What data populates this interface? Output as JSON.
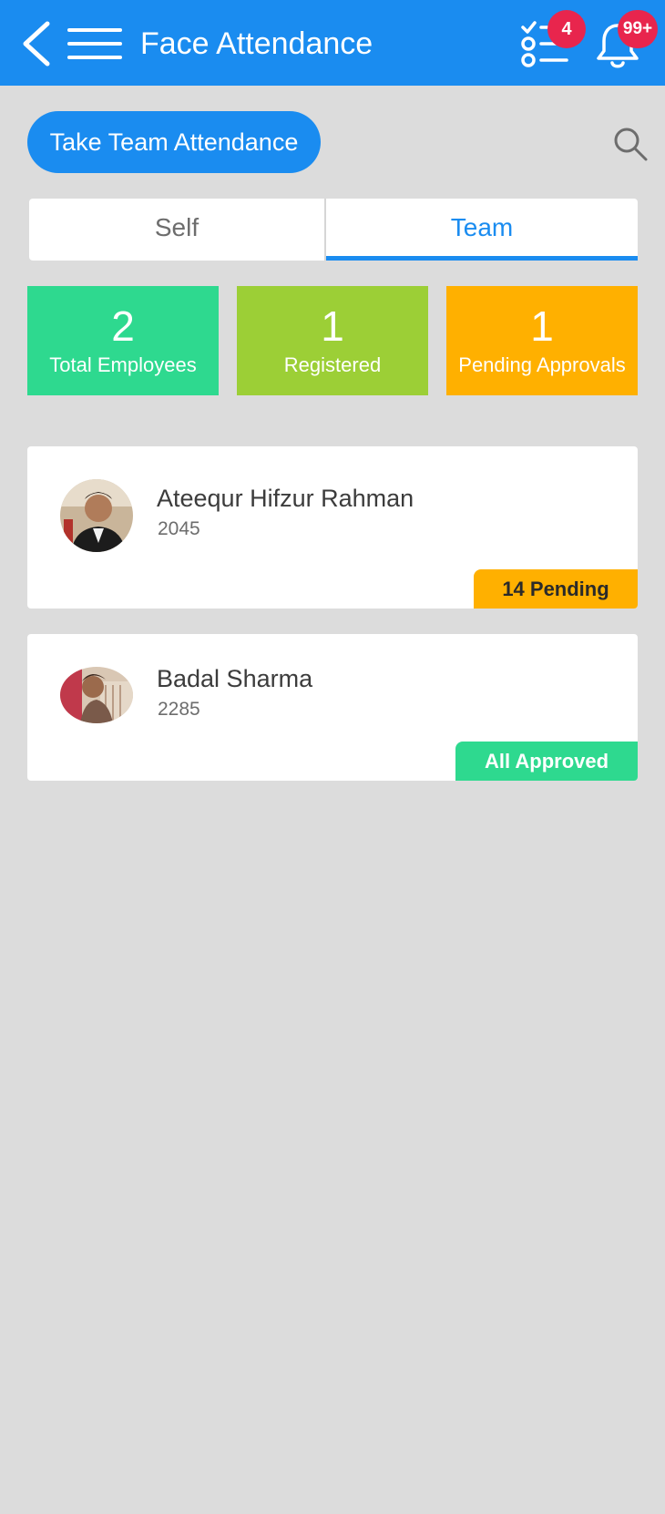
{
  "app_bar": {
    "title": "Face Attendance",
    "tasks_badge": "4",
    "notifications_badge": "99+"
  },
  "actions": {
    "take_team_attendance_label": "Take Team Attendance"
  },
  "tabs": [
    {
      "label": "Self",
      "selected": false
    },
    {
      "label": "Team",
      "selected": true
    }
  ],
  "stats": {
    "total_employees": {
      "value": "2",
      "label": "Total Employees"
    },
    "registered": {
      "value": "1",
      "label": "Registered"
    },
    "pending_approvals": {
      "value": "1",
      "label": "Pending Approvals"
    }
  },
  "employees": [
    {
      "name": "Ateequr Hifzur Rahman",
      "id": "2045",
      "status": "14 Pending"
    },
    {
      "name": "Badal Sharma",
      "id": "2285",
      "status": "All Approved"
    }
  ],
  "colors": {
    "primary": "#1a8cf0",
    "badge": "#e8254d",
    "green": "#2ed98f",
    "lime": "#9ccf36",
    "amber": "#ffb000",
    "background": "#dcdcdc"
  }
}
